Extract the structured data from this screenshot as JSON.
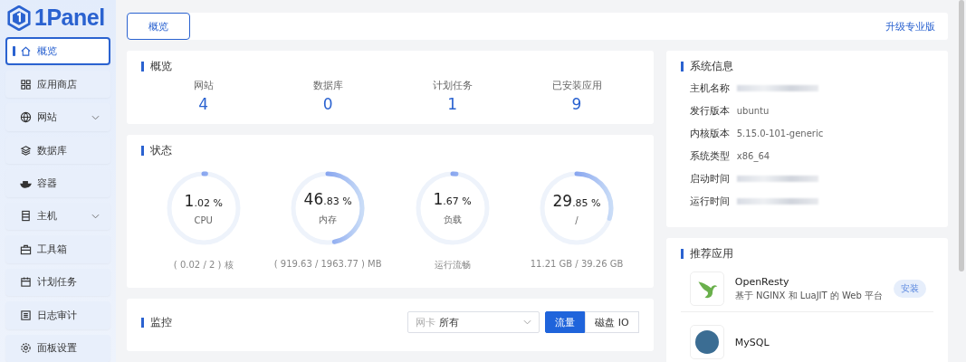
{
  "logo": {
    "text": "1Panel"
  },
  "sidebar": {
    "items": [
      {
        "label": "概览",
        "selected": true,
        "expandable": false
      },
      {
        "label": "应用商店",
        "selected": false,
        "expandable": false
      },
      {
        "label": "网站",
        "selected": false,
        "expandable": true
      },
      {
        "label": "数据库",
        "selected": false,
        "expandable": false
      },
      {
        "label": "容器",
        "selected": false,
        "expandable": false
      },
      {
        "label": "主机",
        "selected": false,
        "expandable": true
      },
      {
        "label": "工具箱",
        "selected": false,
        "expandable": false
      },
      {
        "label": "计划任务",
        "selected": false,
        "expandable": false
      },
      {
        "label": "日志审计",
        "selected": false,
        "expandable": false
      },
      {
        "label": "面板设置",
        "selected": false,
        "expandable": false
      }
    ]
  },
  "top_bar": {
    "tabs": [
      {
        "label": "概览",
        "selected": true
      }
    ],
    "upgrade_link": "升级专业版"
  },
  "overview": {
    "title": "概览",
    "stats": [
      {
        "label": "网站",
        "value": "4"
      },
      {
        "label": "数据库",
        "value": "0"
      },
      {
        "label": "计划任务",
        "value": "1"
      },
      {
        "label": "已安装应用",
        "value": "9"
      }
    ]
  },
  "status": {
    "title": "状态",
    "gauges": [
      {
        "value_main": "1",
        "value_fraction": ".02 %",
        "label": "CPU",
        "detail": "( 0.02 / 2 ) 核",
        "level": 0.0102
      },
      {
        "value_main": "46",
        "value_fraction": ".83 %",
        "label": "内存",
        "detail": "( 919.63 / 1963.77 ) MB",
        "level": 0.4683
      },
      {
        "value_main": "1",
        "value_fraction": ".67 %",
        "label": "负载",
        "detail": "运行流畅",
        "level": 0.0167
      },
      {
        "value_main": "29",
        "value_fraction": ".85 %",
        "label": "/",
        "detail": "11.21 GB / 39.26 GB",
        "level": 0.2985
      }
    ]
  },
  "monitor": {
    "title": "监控",
    "nic_select": {
      "label": "网卡",
      "value": "所有"
    },
    "toggle": [
      {
        "label": "流量",
        "selected": true
      },
      {
        "label": "磁盘 IO",
        "selected": false
      }
    ]
  },
  "system_info": {
    "title": "系统信息",
    "rows": [
      {
        "label": "主机名称",
        "redacted": true
      },
      {
        "label": "发行版本",
        "value": "ubuntu",
        "redacted": false
      },
      {
        "label": "内核版本",
        "value": "5.15.0-101-generic",
        "redacted": false
      },
      {
        "label": "系统类型",
        "value": "x86_64",
        "redacted": false
      },
      {
        "label": "启动时间",
        "redacted": true
      },
      {
        "label": "运行时间",
        "redacted": true
      }
    ]
  },
  "recommended_apps": {
    "title": "推荐应用",
    "apps": [
      {
        "name": "OpenResty",
        "description": "基于 NGINX 和 LuaJIT 的 Web 平台",
        "action": "安装",
        "kind": "openresty"
      },
      {
        "name": "MySQL",
        "kind": "mysql"
      }
    ]
  }
}
